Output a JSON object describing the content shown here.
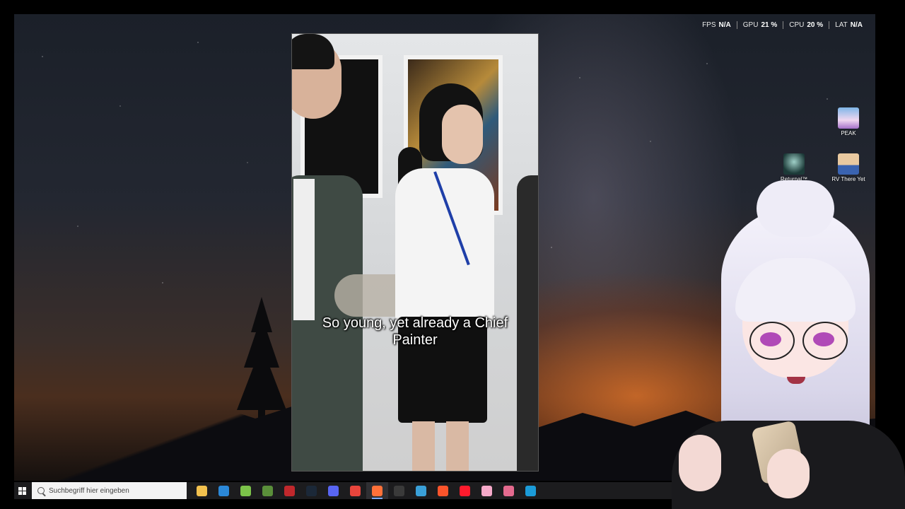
{
  "overlay": {
    "fps_label": "FPS",
    "fps_value": "N/A",
    "gpu_label": "GPU",
    "gpu_value": "21 %",
    "cpu_label": "CPU",
    "cpu_value": "20 %",
    "lat_label": "LAT",
    "lat_value": "N/A"
  },
  "video": {
    "subtitle": "So young, yet already a Chief Painter"
  },
  "desktop_icons": [
    {
      "label": "PEAK"
    },
    {
      "label": "Returnal™"
    },
    {
      "label": "RV There Yet"
    }
  ],
  "taskbar": {
    "search_placeholder": "Suchbegriff hier eingeben",
    "apps": [
      {
        "icon": "file-explorer-icon",
        "color": "#f2c14e"
      },
      {
        "icon": "store-icon",
        "color": "#2b88d8"
      },
      {
        "icon": "android-app-icon",
        "color": "#7cc34a"
      },
      {
        "icon": "minecraft-icon",
        "color": "#5a8f3a"
      },
      {
        "icon": "gog-galaxy-icon",
        "color": "#c0282c"
      },
      {
        "icon": "steam-icon",
        "color": "#1b2838"
      },
      {
        "icon": "discord-icon",
        "color": "#5865f2"
      },
      {
        "icon": "chrome-icon",
        "color": "#e8453c"
      },
      {
        "icon": "firefox-icon",
        "color": "#ff7139"
      },
      {
        "icon": "obs-icon",
        "color": "#3a3a3a"
      },
      {
        "icon": "streamer-app-icon",
        "color": "#3aa0d8"
      },
      {
        "icon": "brave-icon",
        "color": "#fb542b"
      },
      {
        "icon": "opera-icon",
        "color": "#ff1b2d"
      },
      {
        "icon": "vtube-icon",
        "color": "#f6a9c9"
      },
      {
        "icon": "tool-icon",
        "color": "#e46a8e"
      },
      {
        "icon": "steam-icon-2",
        "color": "#1b9bd8"
      }
    ]
  }
}
